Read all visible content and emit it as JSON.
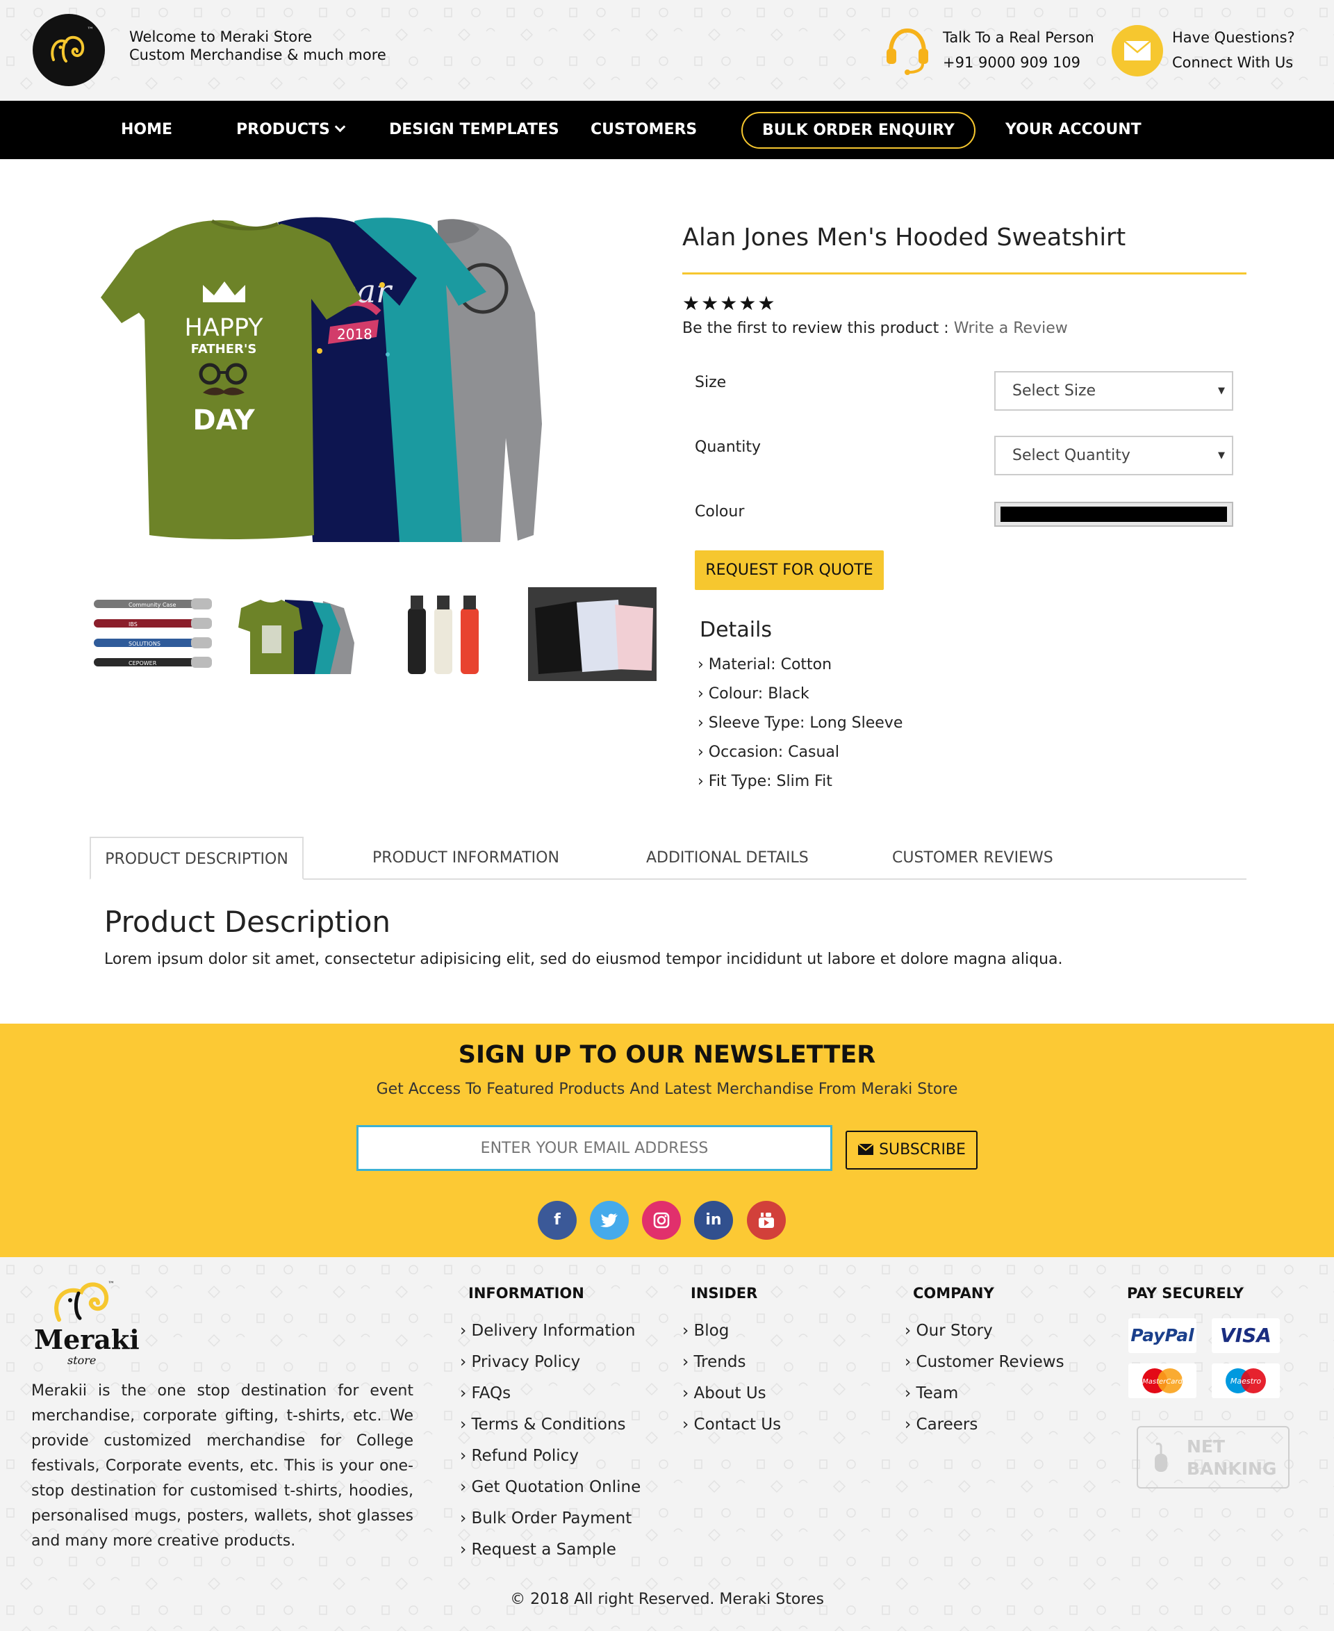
{
  "header": {
    "welcome_line1": "Welcome to Meraki Store",
    "welcome_line2": "Custom Merchandise & much more",
    "talk_label": "Talk To a Real Person",
    "phone": "+91 9000 909 109",
    "questions_label": "Have Questions?",
    "connect_label": "Connect With Us",
    "logo_tm": "™"
  },
  "nav": {
    "home": "HOME",
    "products": "PRODUCTS",
    "design_templates": "DESIGN TEMPLATES",
    "customers": "CUSTOMERS",
    "bulk_order": "BULK ORDER ENQUIRY",
    "your_account": "YOUR ACCOUNT"
  },
  "product": {
    "title": "Alan Jones Men's Hooded Sweatshirt",
    "stars": "★★★★★",
    "rating_stars": 5,
    "review_prompt": "Be the first to review this product : ",
    "review_link": "Write a Review",
    "size_label": "Size",
    "size_value": "Select Size",
    "quantity_label": "Quantity",
    "quantity_value": "Select Quantity",
    "colour_label": "Colour",
    "colour_value": "#000000",
    "quote_button": "REQUEST FOR QUOTE",
    "details_title": "Details",
    "details": [
      "Material: Cotton",
      "Colour: Black",
      "Sleeve Type: Long Sleeve",
      "Occasion: Casual",
      "Fit Type: Slim Fit"
    ],
    "image_text": {
      "happy": "HAPPY",
      "fathers": "FATHER'S",
      "day": "DAY",
      "year": "2018"
    },
    "pen_labels": [
      "Community Case",
      "IBS",
      "SOLUTIONS",
      "CEPOWER"
    ]
  },
  "tabs": {
    "description": "PRODUCT DESCRIPTION",
    "information": "PRODUCT INFORMATION",
    "additional": "ADDITIONAL DETAILS",
    "reviews": "CUSTOMER REVIEWS",
    "active": "PRODUCT DESCRIPTION"
  },
  "description": {
    "title": "Product Description",
    "text": "Lorem ipsum dolor sit amet, consectetur adipisicing elit, sed do eiusmod tempor incididunt ut labore et dolore magna aliqua."
  },
  "newsletter": {
    "title": "SIGN UP TO OUR NEWSLETTER",
    "subtitle": "Get Access To Featured Products And Latest Merchandise From Meraki Store",
    "placeholder": "ENTER YOUR EMAIL ADDRESS",
    "subscribe": "SUBSCRIBE",
    "social": {
      "facebook": "f",
      "linkedin": "in"
    }
  },
  "footer": {
    "logo_name": "Meraki",
    "logo_sub": "store",
    "logo_tm": "™",
    "about": "Merakii is the one stop destination for event merchandise, corporate gifting, t-shirts, etc. We provide customized merchandise for College festivals, Corporate events, etc. This is your one-stop destination for customised t-shirts, hoodies, personalised mugs, posters, wallets, shot glasses and many more creative products.",
    "information_title": "INFORMATION",
    "information": [
      "Delivery Information",
      "Privacy Policy",
      "FAQs",
      "Terms & Conditions",
      "Refund Policy",
      "Get Quotation Online",
      "Bulk Order Payment",
      "Request a Sample"
    ],
    "insider_title": "INSIDER",
    "insider": [
      "Blog",
      "Trends",
      "About Us",
      "Contact Us"
    ],
    "company_title": "COMPANY",
    "company": [
      "Our Story",
      "Customer Reviews",
      "Team",
      "Careers"
    ],
    "pay_title": "PAY SECURELY",
    "pay": {
      "paypal": "PayPal",
      "visa": "VISA",
      "mastercard": "MasterCard",
      "maestro": "Maestro",
      "net": "NET",
      "banking": "BANKING"
    },
    "copyright": "© 2018 All right Reserved.  Meraki Stores"
  },
  "colors": {
    "accent": "#fcc934",
    "nav_bg": "#000000",
    "facebook": "#3b5998",
    "twitter": "#45aaeb",
    "instagram": "#e1306c",
    "linkedin": "#31508e",
    "youtube": "#d2403a"
  }
}
